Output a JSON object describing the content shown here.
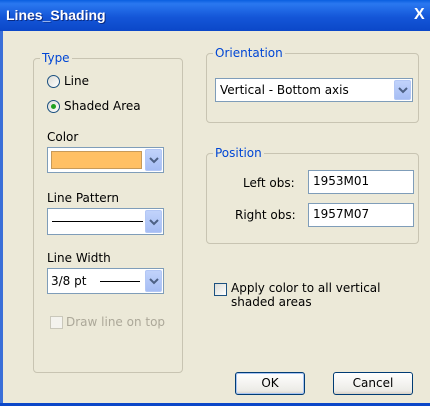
{
  "window": {
    "title": "Lines_Shading",
    "close_glyph": "X"
  },
  "type_group": {
    "title": "Type",
    "line_label": "Line",
    "shaded_label": "Shaded Area",
    "selected": "Shaded Area"
  },
  "color": {
    "label": "Color",
    "swatch_color": "#ffc065"
  },
  "line_pattern": {
    "label": "Line Pattern"
  },
  "line_width": {
    "label": "Line Width",
    "value": "3/8 pt"
  },
  "draw_on_top": {
    "label": "Draw line on top",
    "checked": false,
    "enabled": false
  },
  "orientation": {
    "title": "Orientation",
    "value": "Vertical - Bottom axis"
  },
  "position": {
    "title": "Position",
    "left_label": "Left obs:",
    "left_value": "1953M01",
    "right_label": "Right obs:",
    "right_value": "1957M07"
  },
  "apply_all": {
    "label_line1": "Apply color to all vertical",
    "label_line2": "shaded areas",
    "checked": false
  },
  "buttons": {
    "ok": "OK",
    "cancel": "Cancel"
  },
  "icons": {
    "dropdown": "chevron-down-icon",
    "close": "close-icon"
  }
}
